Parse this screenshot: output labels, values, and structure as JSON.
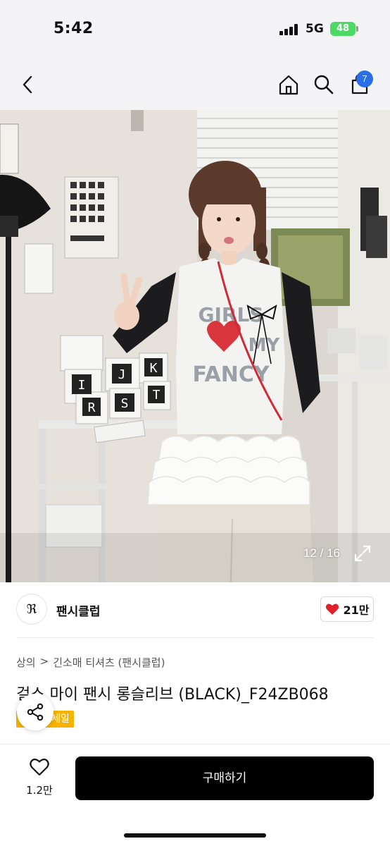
{
  "status": {
    "time": "5:42",
    "network": "5G",
    "battery": "48"
  },
  "nav": {
    "cart_count": "7"
  },
  "gallery": {
    "counter": "12 / 16"
  },
  "shop": {
    "logo_mark": "ℜ",
    "name": "팬시클럽",
    "likes": "21만"
  },
  "breadcrumb": {
    "items": [
      "상의",
      "긴소매 티셔츠 (팬시클럽)"
    ],
    "separator": ">"
  },
  "product": {
    "title": "걸스 마이 팬시 롱슬리브 (BLACK)_F24ZB068",
    "badge": "세일"
  },
  "bottom": {
    "wish_count": "1.2만",
    "buy_label": "구매하기"
  },
  "colors": {
    "buy": "#000000",
    "badge": "#f6b400",
    "cart_badge": "#2b6fe8",
    "heart": "#e0202c",
    "battery": "#4cd964"
  },
  "photo": {
    "shirt_print": [
      "GIRLS",
      "MY",
      "FANCY"
    ],
    "box_letters": [
      "I",
      "J",
      "K",
      "R",
      "S",
      "T"
    ]
  }
}
